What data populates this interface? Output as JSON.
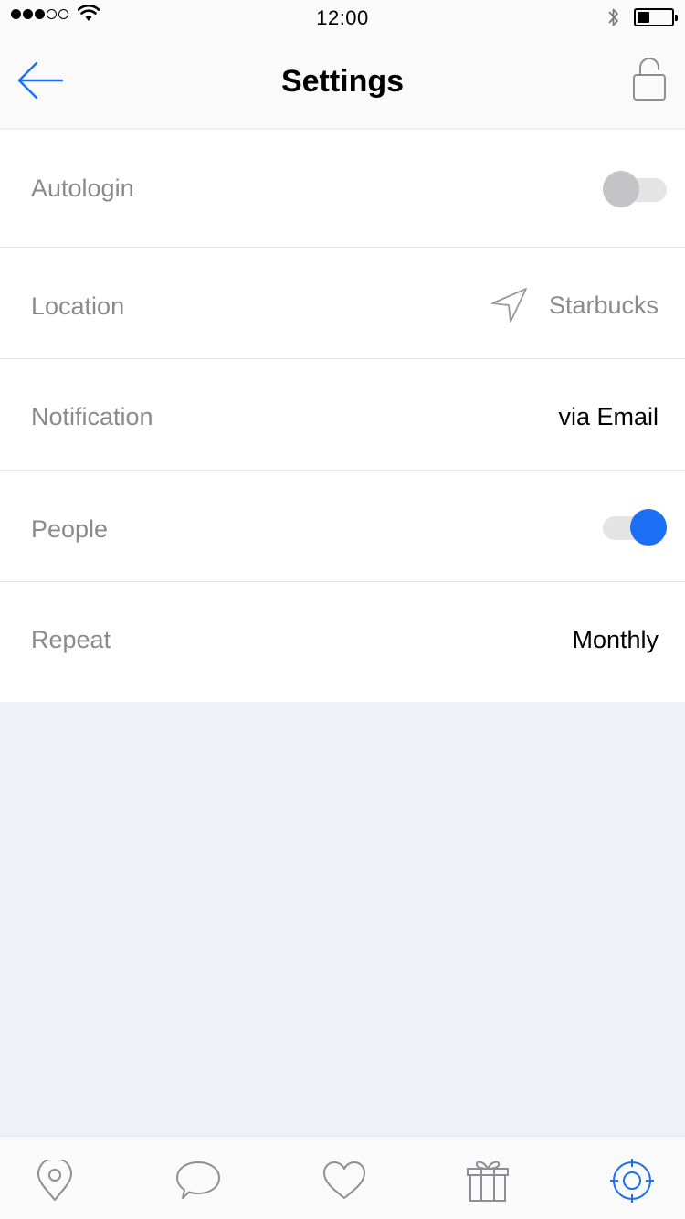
{
  "status_bar": {
    "time": "12:00",
    "signal_bars_filled": 3,
    "signal_bars_total": 5,
    "battery_level": 0.35,
    "icons": [
      "wifi-icon",
      "bluetooth-icon",
      "battery-icon"
    ]
  },
  "nav": {
    "title": "Settings",
    "back_icon": "arrow-left-icon",
    "right_icon": "unlock-icon"
  },
  "settings": {
    "rows": [
      {
        "label": "Autologin",
        "type": "toggle",
        "enabled": false
      },
      {
        "label": "Location",
        "type": "value",
        "value": "Starbucks",
        "icon": "location-arrow-icon"
      },
      {
        "label": "Notification",
        "type": "value",
        "value": "via Email"
      },
      {
        "label": "People",
        "type": "toggle",
        "enabled": true
      },
      {
        "label": "Repeat",
        "type": "value",
        "value": "Monthly"
      }
    ]
  },
  "tab_bar": {
    "tabs": [
      {
        "name": "map-pin-icon",
        "active": false
      },
      {
        "name": "chat-bubble-icon",
        "active": false
      },
      {
        "name": "heart-icon",
        "active": false
      },
      {
        "name": "gift-icon",
        "active": false
      },
      {
        "name": "target-icon",
        "active": true
      }
    ]
  },
  "colors": {
    "accent": "#1a6ff5",
    "label_gray": "#8a8a8a",
    "background": "#eef2f7",
    "icon_gray": "#8e8e93"
  }
}
